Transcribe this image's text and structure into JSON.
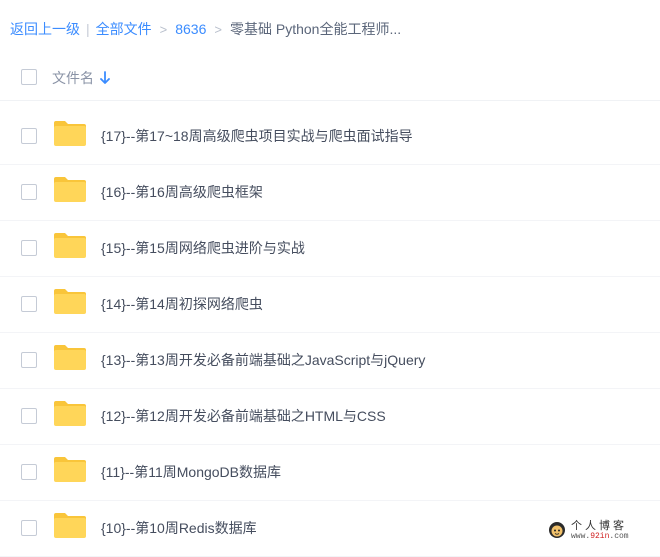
{
  "breadcrumb": {
    "back": "返回上一级",
    "all_files": "全部文件",
    "level1": "8636",
    "current": "零基础 Python全能工程师...",
    "pipe": "|",
    "sep": ">"
  },
  "header": {
    "name_column": "文件名",
    "sort_icon": "arrow-down-icon"
  },
  "files": [
    {
      "name": "{17}--第17~18周高级爬虫项目实战与爬虫面试指导",
      "icon": "folder-icon"
    },
    {
      "name": "{16}--第16周高级爬虫框架",
      "icon": "folder-icon"
    },
    {
      "name": "{15}--第15周网络爬虫进阶与实战",
      "icon": "folder-icon"
    },
    {
      "name": "{14}--第14周初探网络爬虫",
      "icon": "folder-icon"
    },
    {
      "name": "{13}--第13周开发必备前端基础之JavaScript与jQuery",
      "icon": "folder-icon"
    },
    {
      "name": "{12}--第12周开发必备前端基础之HTML与CSS",
      "icon": "folder-icon"
    },
    {
      "name": "{11}--第11周MongoDB数据库",
      "icon": "folder-icon"
    },
    {
      "name": "{10}--第10周Redis数据库",
      "icon": "folder-icon"
    }
  ],
  "watermark": {
    "title": "个人博客",
    "url_prefix": "www.",
    "url_mid": "92in",
    "url_suffix": ".com"
  },
  "colors": {
    "link": "#3b8cff",
    "folder": "#ffd659",
    "folder_tab": "#f9c53a"
  }
}
